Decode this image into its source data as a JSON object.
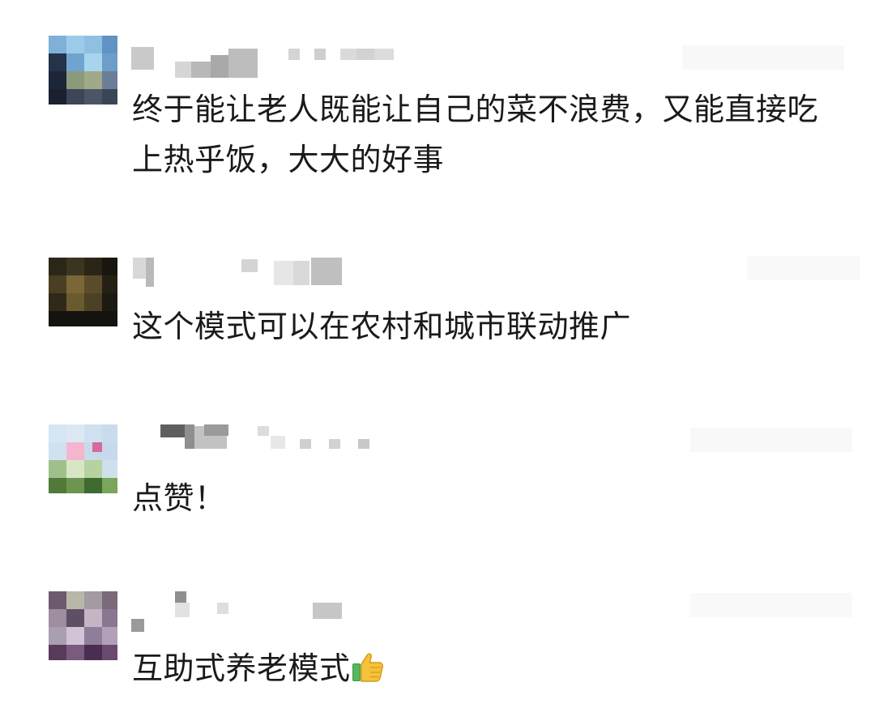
{
  "comments": [
    {
      "avatar_icon": "blurred-avatar",
      "username_icon": "blurred-username",
      "text": "终于能让老人既能让自己的菜不浪费，又能直接吃上热乎饭，大大的好事"
    },
    {
      "avatar_icon": "blurred-avatar",
      "username_icon": "blurred-username",
      "text": "这个模式可以在农村和城市联动推广"
    },
    {
      "avatar_icon": "blurred-avatar",
      "username_icon": "blurred-username",
      "text": "点赞！"
    },
    {
      "avatar_icon": "blurred-avatar",
      "username_icon": "blurred-username",
      "text": "互助式养老模式",
      "emoji_icon": "thumbs-up-icon"
    }
  ]
}
